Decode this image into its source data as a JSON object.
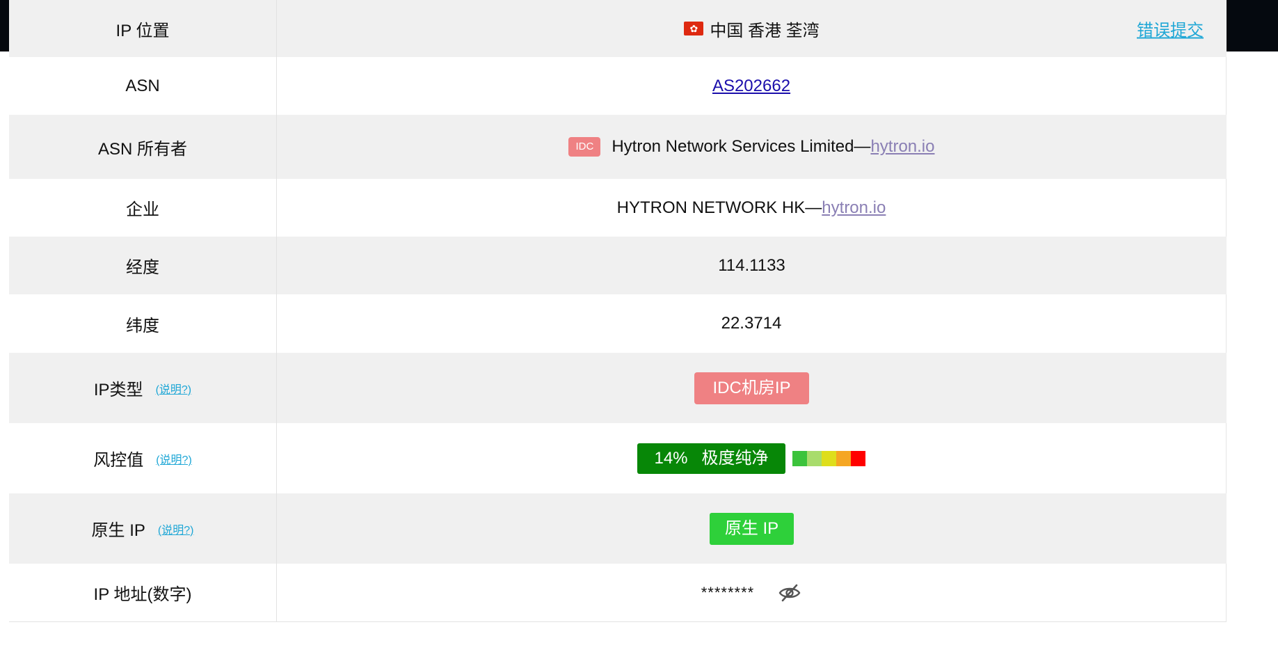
{
  "rows": {
    "location": {
      "label": "IP 位置",
      "value": "中国 香港 荃湾",
      "flag_icon": "hong-kong-flag-icon",
      "report_link": "错误提交"
    },
    "asn": {
      "label": "ASN",
      "value": "AS202662"
    },
    "asn_owner": {
      "label": "ASN 所有者",
      "badge": "IDC",
      "name": "Hytron Network Services Limited—",
      "link": "hytron.io"
    },
    "enterprise": {
      "label": "企业",
      "name": "HYTRON NETWORK HK—",
      "link": "hytron.io"
    },
    "longitude": {
      "label": "经度",
      "value": "114.1133"
    },
    "latitude": {
      "label": "纬度",
      "value": "22.3714"
    },
    "ip_type": {
      "label": "IP类型",
      "help": "(说明?)",
      "value": "IDC机房IP"
    },
    "risk": {
      "label": "风控值",
      "help": "(说明?)",
      "value": "14%   极度纯净",
      "percent": 14,
      "scale_colors": [
        "#3cc33c",
        "#a8dc6c",
        "#dede1c",
        "#f5a623",
        "#ff0000"
      ]
    },
    "native_ip": {
      "label": "原生 IP",
      "help": "(说明?)",
      "value": "原生 IP"
    },
    "ip_numeric": {
      "label": "IP 地址(数字)",
      "value": "********",
      "toggle_icon": "eye-off-icon"
    }
  },
  "colors": {
    "row_gray": "#f0f0f0",
    "link_cyan": "#1fa7d6",
    "link_blue": "#1a0dab",
    "link_purple": "#8a7fb4",
    "idc_red": "#ef8183",
    "risk_green": "#078707",
    "native_green": "#2ed03a"
  }
}
